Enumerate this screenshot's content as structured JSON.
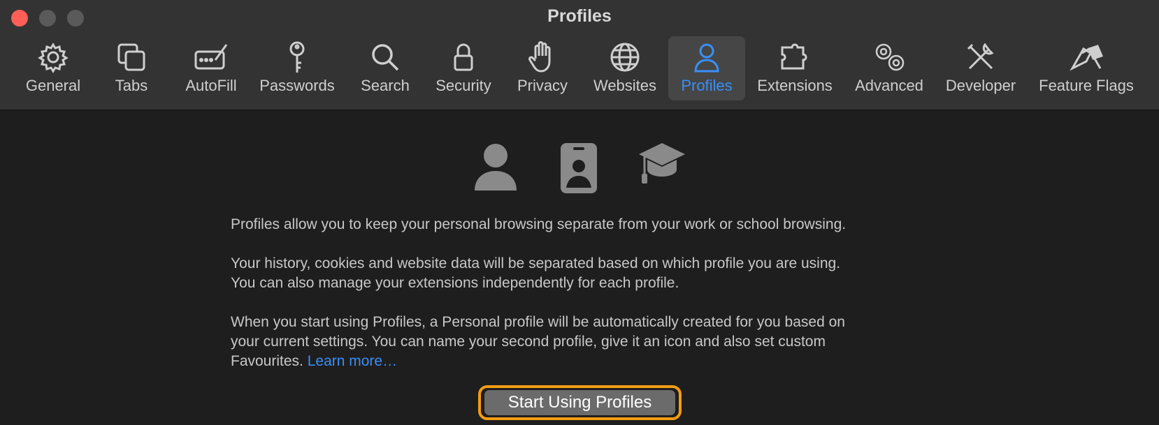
{
  "window": {
    "title": "Profiles"
  },
  "toolbar": {
    "tabs": [
      {
        "label": "General",
        "icon": "gear-icon"
      },
      {
        "label": "Tabs",
        "icon": "tabs-icon"
      },
      {
        "label": "AutoFill",
        "icon": "autofill-icon"
      },
      {
        "label": "Passwords",
        "icon": "key-icon"
      },
      {
        "label": "Search",
        "icon": "search-icon"
      },
      {
        "label": "Security",
        "icon": "lock-icon"
      },
      {
        "label": "Privacy",
        "icon": "hand-icon"
      },
      {
        "label": "Websites",
        "icon": "globe-icon"
      },
      {
        "label": "Profiles",
        "icon": "person-icon",
        "active": true
      },
      {
        "label": "Extensions",
        "icon": "puzzle-icon"
      },
      {
        "label": "Advanced",
        "icon": "gears-icon"
      },
      {
        "label": "Developer",
        "icon": "tools-icon"
      },
      {
        "label": "Feature Flags",
        "icon": "flags-icon"
      }
    ]
  },
  "content": {
    "paragraph1": "Profiles allow you to keep your personal browsing separate from your work or school browsing.",
    "paragraph2_line1": "Your history, cookies and website data will be separated based on which profile you are using.",
    "paragraph2_line2": "You can also manage your extensions independently for each profile.",
    "paragraph3_line1": "When you start using Profiles, a Personal profile will be automatically created for you based on",
    "paragraph3_line2": "your current settings. You can name your second profile, give it an icon and also set custom",
    "paragraph3_line3": "Favourites.",
    "learn_more": "Learn more…",
    "start_button": "Start Using Profiles"
  },
  "colors": {
    "accent": "#3a8ff6",
    "highlight": "#f39c12",
    "close": "#ff5f57"
  }
}
